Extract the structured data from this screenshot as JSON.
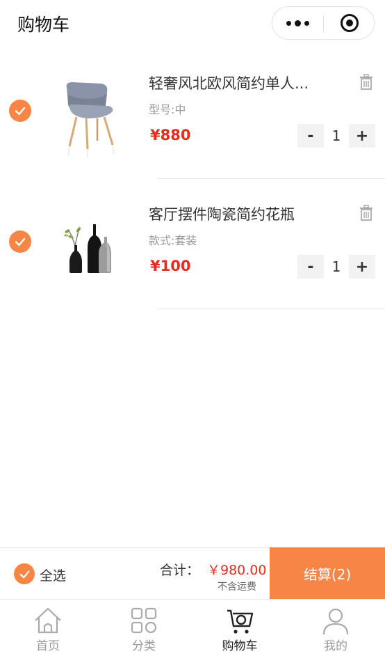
{
  "header": {
    "title": "购物车"
  },
  "capsule": {
    "more_icon": "more-dots-icon",
    "close_icon": "target-icon"
  },
  "items": [
    {
      "name": "轻奢风北欧风简约单人...",
      "spec": "型号:中",
      "price": "¥880",
      "quantity": "1",
      "minus": "-",
      "plus": "+",
      "checked": true,
      "image": "chair-image",
      "delete_icon": "trash-icon"
    },
    {
      "name": "客厅摆件陶瓷简约花瓶",
      "spec": "款式:套装",
      "price": "¥100",
      "quantity": "1",
      "minus": "-",
      "plus": "+",
      "checked": true,
      "image": "vase-set-image",
      "delete_icon": "trash-icon"
    }
  ],
  "footer": {
    "select_all_label": "全选",
    "total_label": "合计：",
    "total_value": "￥980.00",
    "shipping_note": "不含运费",
    "checkout_label": "结算(2)"
  },
  "tabbar": {
    "tabs": [
      {
        "label": "首页",
        "icon": "home-icon",
        "active": false
      },
      {
        "label": "分类",
        "icon": "category-icon",
        "active": false
      },
      {
        "label": "购物车",
        "icon": "cart-icon",
        "active": true
      },
      {
        "label": "我的",
        "icon": "user-icon",
        "active": false
      }
    ]
  },
  "colors": {
    "accent": "#f78545",
    "price": "#ea2a1f",
    "muted": "#999999",
    "stepper_bg": "#f2f2f2"
  }
}
